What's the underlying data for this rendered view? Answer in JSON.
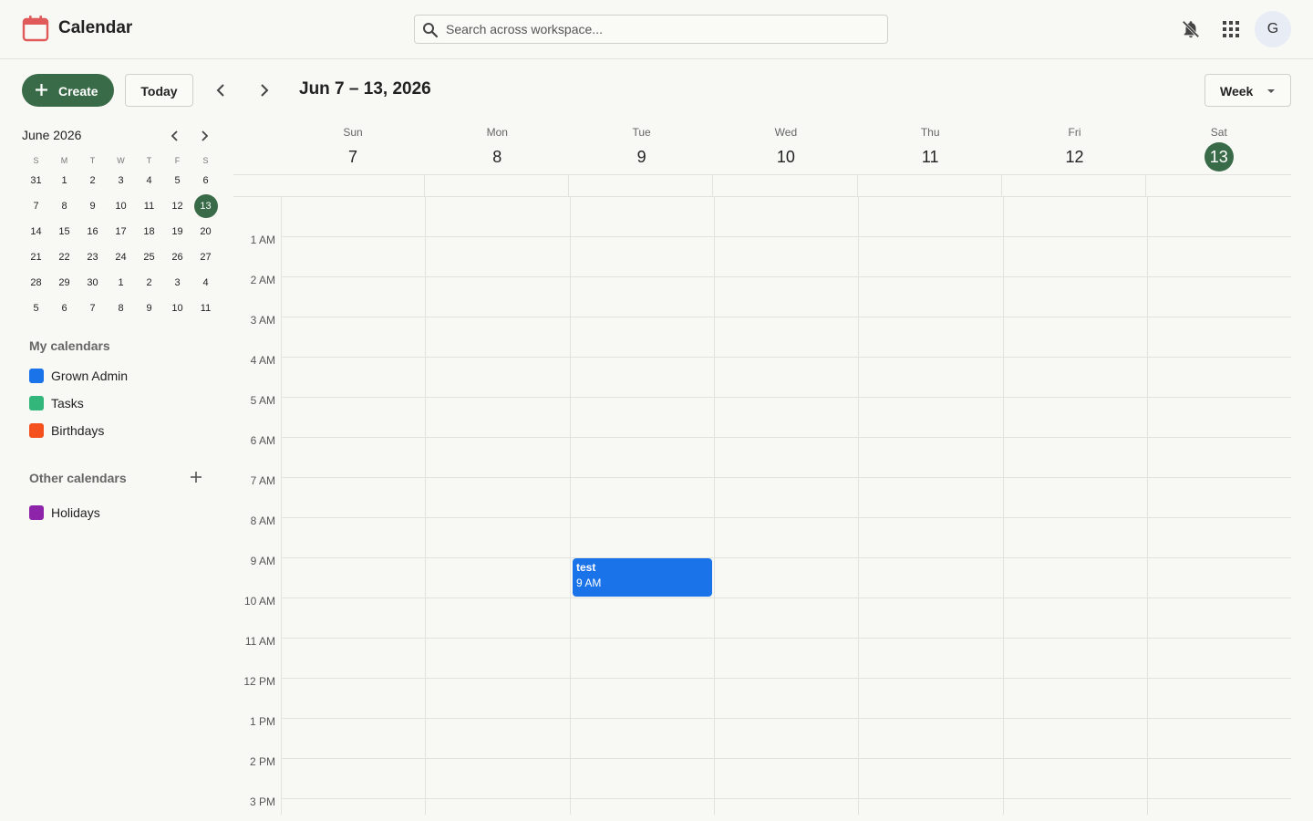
{
  "header": {
    "app_title": "Calendar",
    "search_placeholder": "Search across workspace...",
    "avatar_initial": "G"
  },
  "toolbar": {
    "create_label": "Create",
    "today_label": "Today",
    "range_title": "Jun 7 – 13, 2026",
    "view_label": "Week"
  },
  "mini_calendar": {
    "title": "June 2026",
    "weekday_initials": [
      "S",
      "M",
      "T",
      "W",
      "T",
      "F",
      "S"
    ],
    "weeks": [
      [
        "31",
        "1",
        "2",
        "3",
        "4",
        "5",
        "6"
      ],
      [
        "7",
        "8",
        "9",
        "10",
        "11",
        "12",
        "13"
      ],
      [
        "14",
        "15",
        "16",
        "17",
        "18",
        "19",
        "20"
      ],
      [
        "21",
        "22",
        "23",
        "24",
        "25",
        "26",
        "27"
      ],
      [
        "28",
        "29",
        "30",
        "1",
        "2",
        "3",
        "4"
      ],
      [
        "5",
        "6",
        "7",
        "8",
        "9",
        "10",
        "11"
      ]
    ],
    "selected": "13"
  },
  "my_calendars": {
    "title": "My calendars",
    "items": [
      {
        "label": "Grown Admin",
        "color": "#1a73e8"
      },
      {
        "label": "Tasks",
        "color": "#33b679"
      },
      {
        "label": "Birthdays",
        "color": "#f4511e"
      }
    ]
  },
  "other_calendars": {
    "title": "Other calendars",
    "items": [
      {
        "label": "Holidays",
        "color": "#8e24aa"
      }
    ]
  },
  "week": {
    "days": [
      {
        "dow": "Sun",
        "num": "7"
      },
      {
        "dow": "Mon",
        "num": "8"
      },
      {
        "dow": "Tue",
        "num": "9"
      },
      {
        "dow": "Wed",
        "num": "10"
      },
      {
        "dow": "Thu",
        "num": "11"
      },
      {
        "dow": "Fri",
        "num": "12"
      },
      {
        "dow": "Sat",
        "num": "13",
        "today": true
      }
    ],
    "hour_labels": [
      "1 AM",
      "2 AM",
      "3 AM",
      "4 AM",
      "5 AM",
      "6 AM",
      "7 AM",
      "8 AM",
      "9 AM",
      "10 AM",
      "11 AM",
      "12 PM",
      "1 PM",
      "2 PM",
      "3 PM"
    ]
  },
  "events": [
    {
      "title": "test",
      "time": "9 AM",
      "day": "Tue",
      "color": "#1a73e8"
    }
  ],
  "colors": {
    "accent": "#3a6b48",
    "grid_line": "#e2e2de",
    "background": "#f8f8f5",
    "logo": "#e05a5a"
  }
}
